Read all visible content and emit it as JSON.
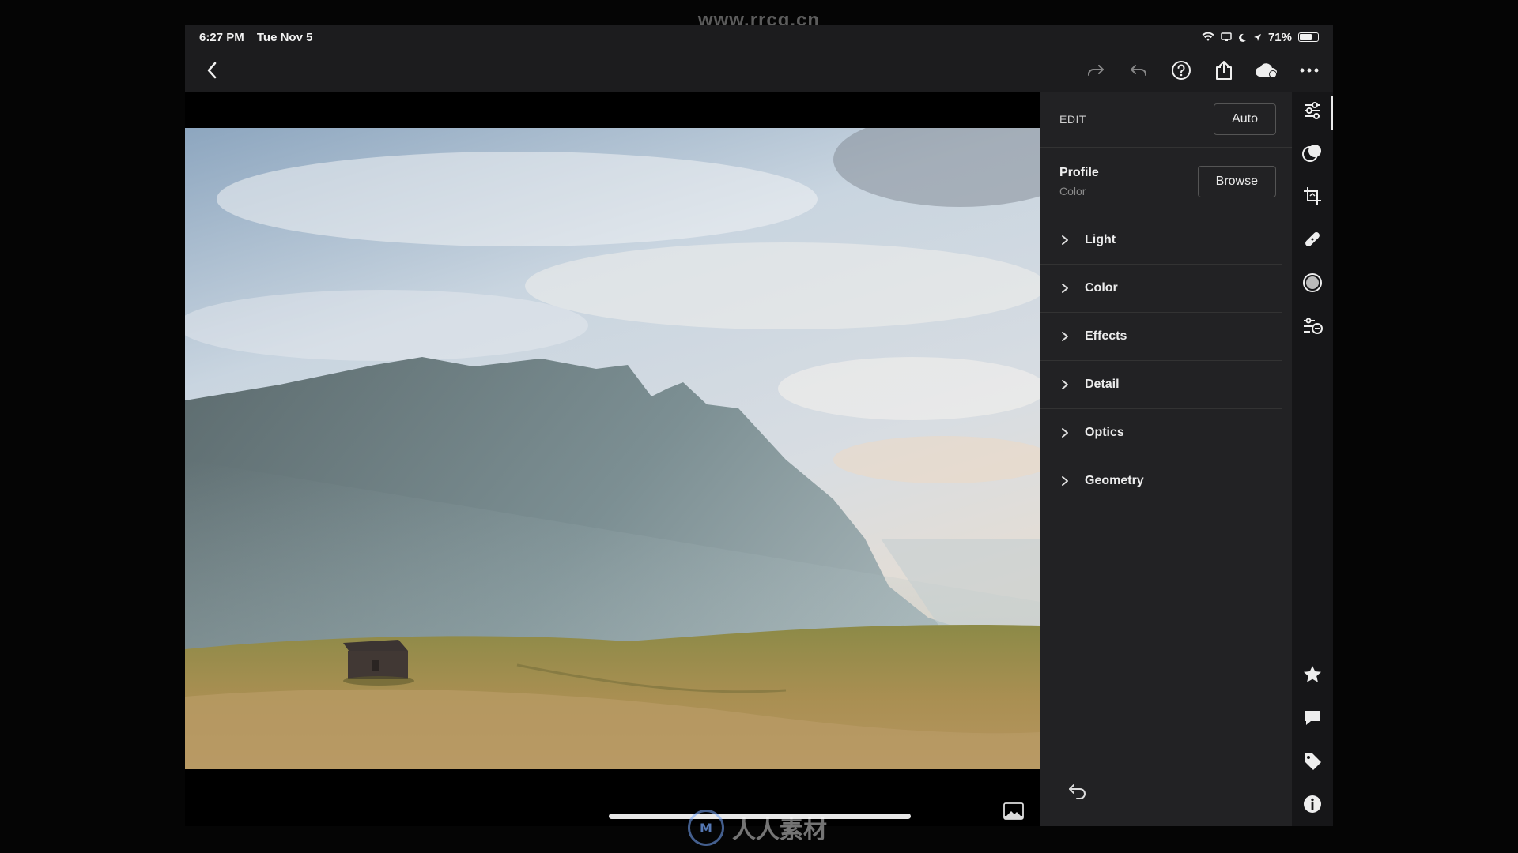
{
  "watermark": {
    "url": "www.rrcg.cn",
    "bottom_text": "人人素材"
  },
  "status": {
    "time": "6:27 PM",
    "date": "Tue Nov 5",
    "battery": "71%",
    "battery_level": 0.71
  },
  "toolbar": {
    "icons": [
      "back-icon",
      "redo-icon",
      "undo-icon",
      "help-icon",
      "share-icon",
      "cloud-sync-icon",
      "more-icon"
    ]
  },
  "edit": {
    "title": "EDIT",
    "auto_label": "Auto",
    "profile": {
      "label": "Profile",
      "value": "Color",
      "browse_label": "Browse"
    },
    "sections": [
      {
        "label": "Light"
      },
      {
        "label": "Color"
      },
      {
        "label": "Effects"
      },
      {
        "label": "Detail"
      },
      {
        "label": "Optics"
      },
      {
        "label": "Geometry"
      }
    ]
  },
  "rail": {
    "top": [
      "edit-sliders-icon",
      "selective-icon",
      "crop-icon",
      "healing-icon",
      "radial-icon",
      "presets-icon"
    ],
    "bottom": [
      "star-icon",
      "comment-icon",
      "tag-icon",
      "info-icon"
    ]
  },
  "colors": {
    "panel": "#222224",
    "rail": "#161618",
    "accent": "#eaeaea"
  }
}
